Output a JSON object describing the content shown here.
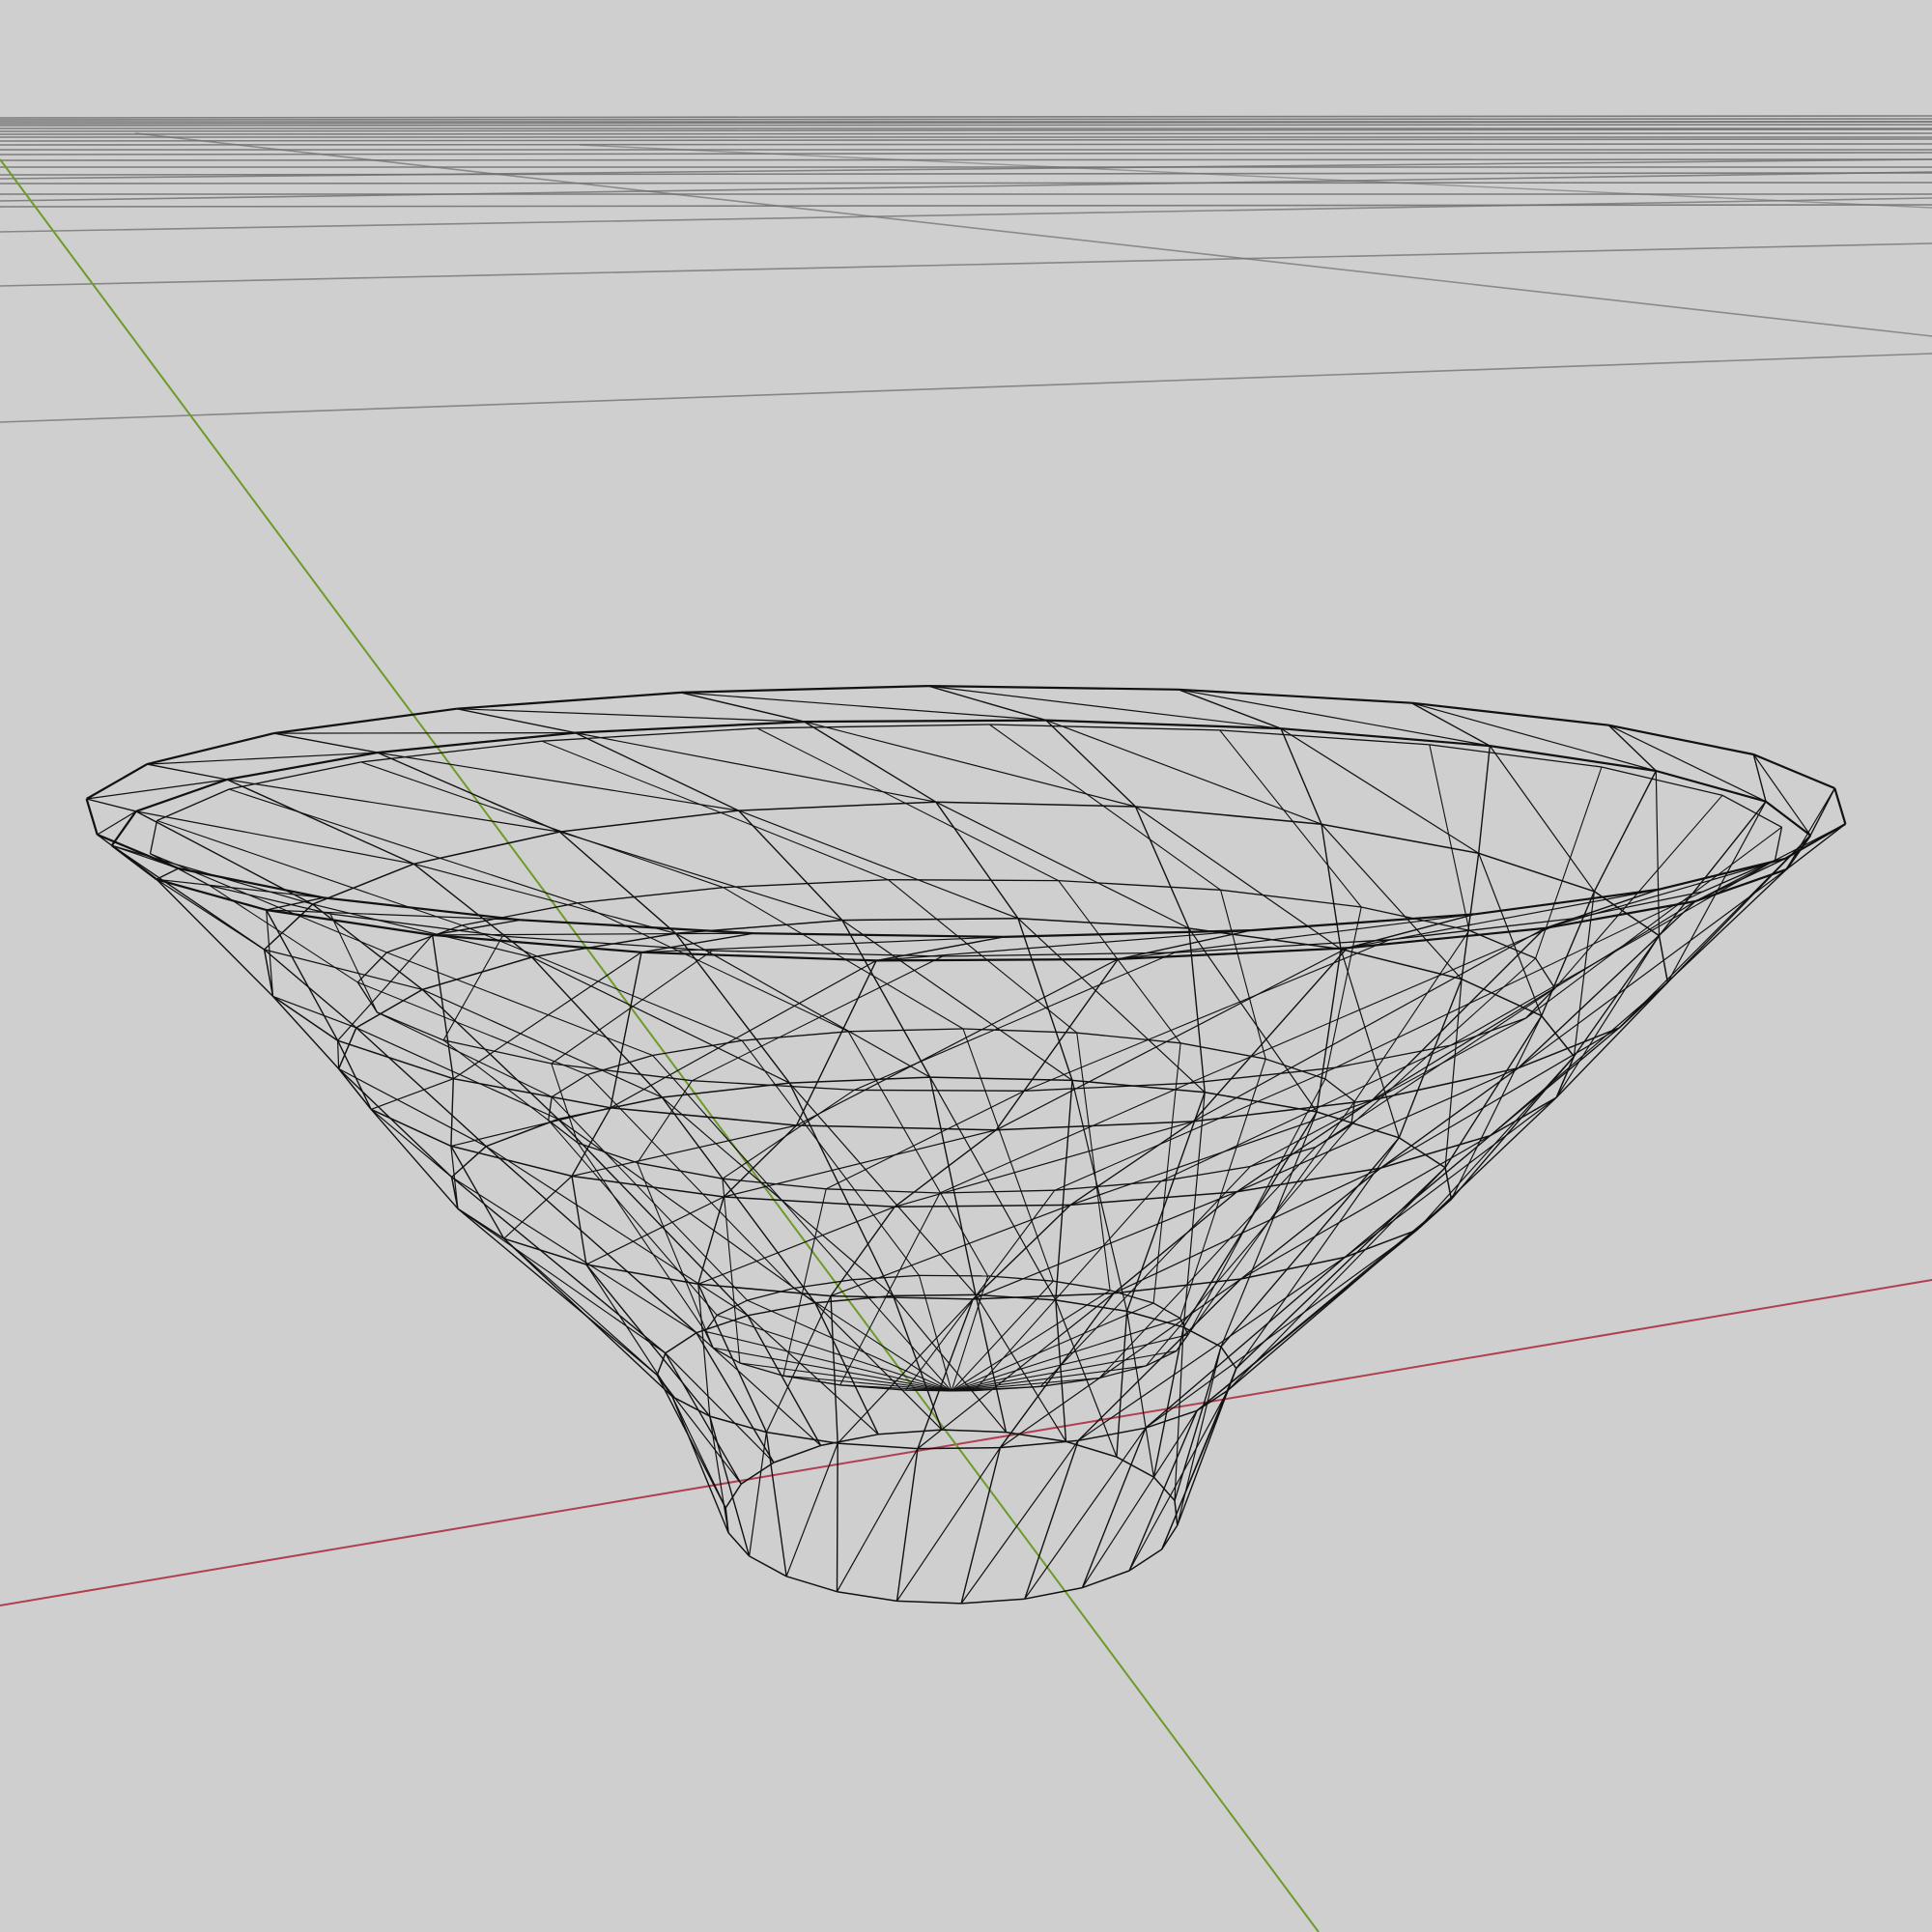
{
  "viewport": {
    "view_mode": "wireframe",
    "background_color": "#cfcfcf",
    "grid_color": "#6e6e6e",
    "mesh_color": "#111111",
    "object": "bowl",
    "axes": [
      {
        "name": "x-axis",
        "color": "#b04050"
      },
      {
        "name": "y-axis",
        "color": "#6e9a2a"
      }
    ]
  }
}
